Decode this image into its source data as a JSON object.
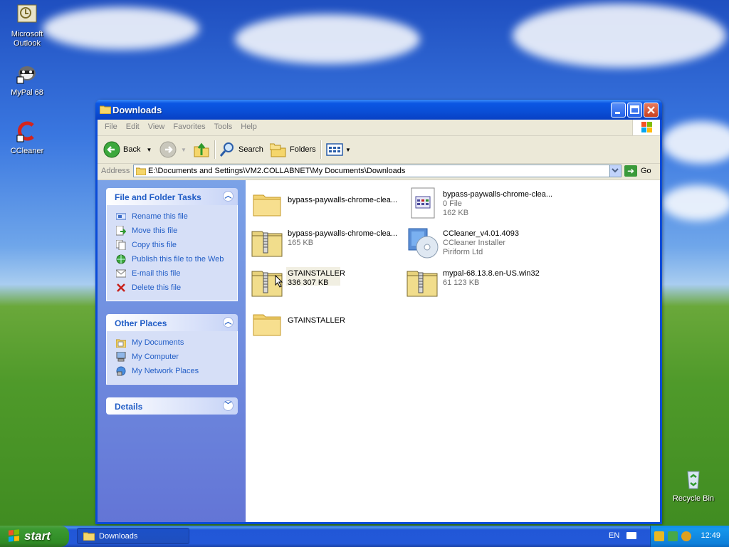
{
  "desktop": {
    "icons": [
      {
        "label_line1": "Microsoft",
        "label_line2": "Outlook",
        "icon": "outlook-icon"
      },
      {
        "label_line1": "MyPal 68",
        "label_line2": "",
        "icon": "mypal-raccoon-icon"
      },
      {
        "label_line1": "CCleaner",
        "label_line2": "",
        "icon": "ccleaner-icon"
      },
      {
        "label_line1": "Recycle Bin",
        "label_line2": "",
        "icon": "recycle-bin-icon"
      }
    ]
  },
  "window": {
    "title": "Downloads",
    "menu": [
      "File",
      "Edit",
      "View",
      "Favorites",
      "Tools",
      "Help"
    ],
    "toolbar": {
      "back": "Back",
      "search": "Search",
      "folders": "Folders"
    },
    "address": {
      "label": "Address",
      "path": "E:\\Documents and Settings\\VM2.COLLABNET\\My Documents\\Downloads",
      "go": "Go"
    },
    "tasks": {
      "file_folder": {
        "title": "File and Folder Tasks",
        "items": [
          "Rename this file",
          "Move this file",
          "Copy this file",
          "Publish this file to the Web",
          "E-mail this file",
          "Delete this file"
        ]
      },
      "other_places": {
        "title": "Other Places",
        "items": [
          "My Documents",
          "My Computer",
          "My Network Places"
        ]
      },
      "details": {
        "title": "Details"
      }
    },
    "files": [
      {
        "name": "bypass-paywalls-chrome-clea...",
        "line2": "",
        "line3": "",
        "type": "folder"
      },
      {
        "name": "bypass-paywalls-chrome-clea...",
        "line2": "0 File",
        "line3": "162 KB",
        "type": "document"
      },
      {
        "name": "bypass-paywalls-chrome-clea...",
        "line2": "165 KB",
        "line3": "",
        "type": "zip"
      },
      {
        "name": "CCleaner_v4.01.4093",
        "line2": "CCleaner Installer",
        "line3": "Piriform Ltd",
        "type": "installer"
      },
      {
        "name": "GTAINSTALLER",
        "line2": "336 307 KB",
        "line3": "",
        "type": "zip"
      },
      {
        "name": "mypal-68.13.8.en-US.win32",
        "line2": "61 123 KB",
        "line3": "",
        "type": "zip"
      },
      {
        "name": "GTAINSTALLER",
        "line2": "",
        "line3": "",
        "type": "folder"
      }
    ]
  },
  "taskbar": {
    "start": "start",
    "task": "Downloads",
    "language": "EN",
    "clock": "12:49"
  },
  "colors": {
    "title_blue": "#0a4ed6",
    "task_link": "#215dc6",
    "start_green": "#3c9a32"
  }
}
